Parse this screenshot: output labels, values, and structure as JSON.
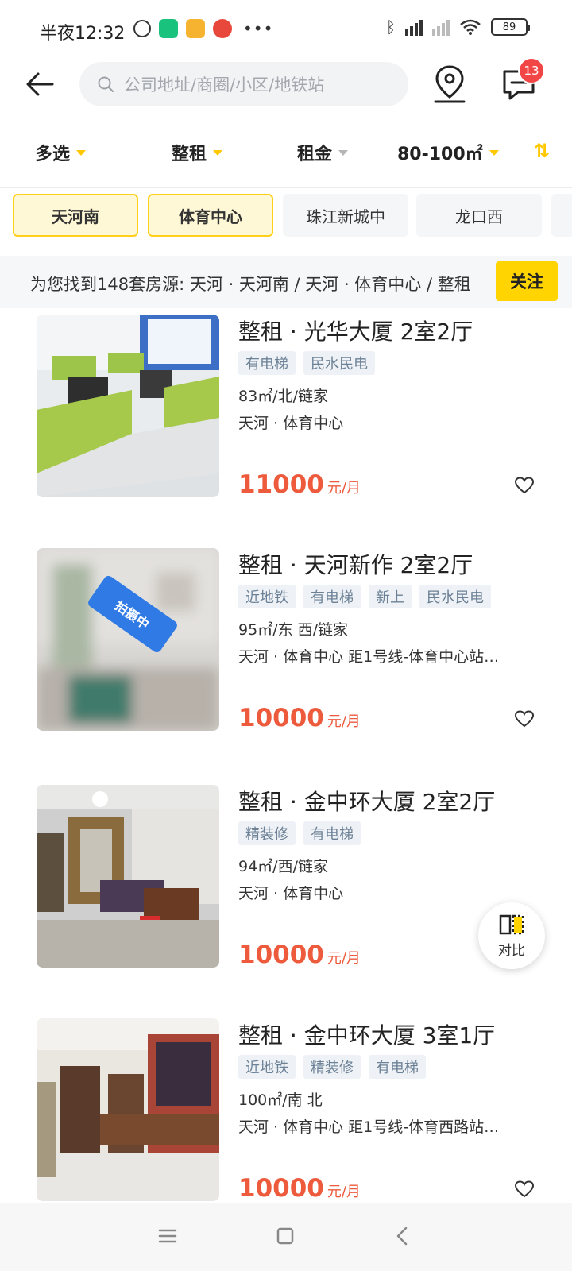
{
  "status_bar": {
    "time": "半夜12:32",
    "dots": "•••",
    "battery": "89"
  },
  "header": {
    "search_placeholder": "公司地址/商圈/小区/地铁站",
    "message_badge": "13"
  },
  "filters": [
    {
      "label": "多选"
    },
    {
      "label": "整租"
    },
    {
      "label": "租金"
    },
    {
      "label": "80-100㎡"
    }
  ],
  "chips": [
    {
      "label": "天河南",
      "active": true
    },
    {
      "label": "体育中心",
      "active": true
    },
    {
      "label": "珠江新城中",
      "active": false
    },
    {
      "label": "龙口西",
      "active": false
    }
  ],
  "result_bar": {
    "text": "为您找到148套房源: 天河 · 天河南 / 天河 · 体育中心 / 整租",
    "follow_label": "关注"
  },
  "listings": [
    {
      "title": "整租 · 光华大厦 2室2厅",
      "tags": [
        "有电梯",
        "民水民电"
      ],
      "meta": "83㎡/北/链家",
      "location": "天河 · 体育中心",
      "price": "11000",
      "unit": "元/月"
    },
    {
      "title": "整租 · 天河新作 2室2厅",
      "tags": [
        "近地铁",
        "有电梯",
        "新上",
        "民水民电"
      ],
      "meta": "95㎡/东 西/链家",
      "location": "天河 · 体育中心 距1号线-体育中心站…",
      "price": "10000",
      "unit": "元/月",
      "photo_badge": "拍摄中"
    },
    {
      "title": "整租 · 金中环大厦 2室2厅",
      "tags": [
        "精装修",
        "有电梯"
      ],
      "meta": "94㎡/西/链家",
      "location": "天河 · 体育中心",
      "price": "10000",
      "unit": "元/月"
    },
    {
      "title": "整租 · 金中环大厦 3室1厅",
      "tags": [
        "近地铁",
        "精装修",
        "有电梯"
      ],
      "meta": "100㎡/南 北",
      "location": "天河 · 体育中心 距1号线-体育西路站…",
      "price": "10000",
      "unit": "元/月"
    }
  ],
  "compare": {
    "label": "对比"
  }
}
